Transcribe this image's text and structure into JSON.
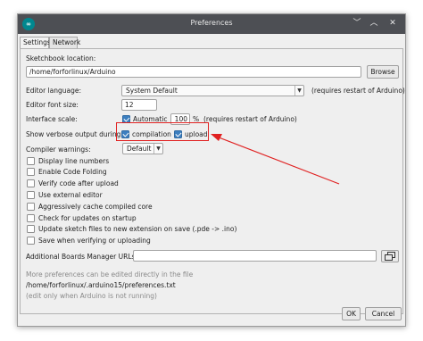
{
  "window": {
    "title": "Preferences",
    "app_icon": "arduino-logo",
    "app_icon_glyph": "∞"
  },
  "tabs": [
    {
      "label": "Settings",
      "active": true
    },
    {
      "label": "Network",
      "active": false
    }
  ],
  "sketchbook": {
    "label": "Sketchbook location:",
    "value": "/home/forforlinux/Arduino",
    "browse_label": "Browse"
  },
  "editor_language": {
    "label": "Editor language:",
    "value": "System Default",
    "note": "(requires restart of Arduino)"
  },
  "editor_font_size": {
    "label": "Editor font size:",
    "value": "12"
  },
  "interface_scale": {
    "label": "Interface scale:",
    "automatic_label": "Automatic",
    "automatic_checked": true,
    "value": "100",
    "unit": "%",
    "note": "(requires restart of Arduino)"
  },
  "verbose": {
    "label": "Show verbose output during:",
    "compilation_label": "compilation",
    "compilation_checked": true,
    "upload_label": "upload",
    "upload_checked": true
  },
  "compiler_warnings": {
    "label": "Compiler warnings:",
    "value": "Default"
  },
  "options": [
    {
      "label": "Display line numbers",
      "checked": false
    },
    {
      "label": "Enable Code Folding",
      "checked": false
    },
    {
      "label": "Verify code after upload",
      "checked": true
    },
    {
      "label": "Use external editor",
      "checked": false
    },
    {
      "label": "Aggressively cache compiled core",
      "checked": true
    },
    {
      "label": "Check for updates on startup",
      "checked": false
    },
    {
      "label": "Update sketch files to new extension on save (.pde -> .ino)",
      "checked": true
    },
    {
      "label": "Save when verifying or uploading",
      "checked": true
    }
  ],
  "boards_manager": {
    "label": "Additional Boards Manager URLs:",
    "value": ""
  },
  "footer": {
    "line1": "More preferences can be edited directly in the file",
    "line2": "/home/forforlinux/.arduino15/preferences.txt",
    "line3": "(edit only when Arduino is not running)"
  },
  "buttons": {
    "ok": "OK",
    "cancel": "Cancel"
  },
  "annotation_color": "#e02020",
  "accent_color": "#3c7fc0"
}
